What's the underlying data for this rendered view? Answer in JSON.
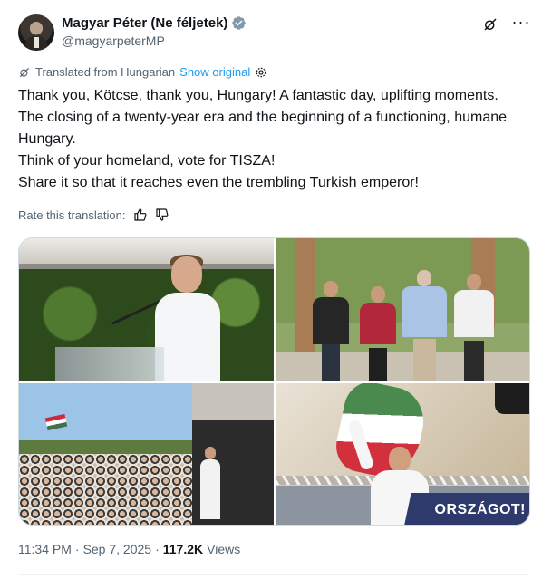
{
  "author": {
    "display_name": "Magyar Péter (Ne féljetek)",
    "handle": "@magyarpeterMP",
    "verified": true,
    "verified_color": "#829aab"
  },
  "header_icons": [
    "grok-icon",
    "more-options-icon"
  ],
  "translation": {
    "note": "Translated from Hungarian",
    "show_original": "Show original",
    "settings_icon": "gear-icon"
  },
  "tweet": {
    "lines": [
      "Thank you, Kötcse, thank you, Hungary! A fantastic day, uplifting moments. The closing of a twenty-year era and the beginning of a functioning, humane Hungary.",
      "Think of your homeland, vote for TISZA!",
      "Share it so that it reaches even the trembling Turkish emperor!"
    ]
  },
  "rate": {
    "label": "Rate this translation:",
    "icons": [
      "thumbs-up-icon",
      "thumbs-down-icon"
    ]
  },
  "media": {
    "photo_4_banner": "ORSZÁGOT!"
  },
  "meta": {
    "time": "11:34 PM",
    "sep1": "·",
    "date": "Sep 7, 2025",
    "sep2": "·",
    "views_count": "117.2K",
    "views_label": "Views"
  },
  "colors": {
    "text": "#0f1419",
    "secondary": "#536471",
    "link": "#1d9bf0"
  }
}
